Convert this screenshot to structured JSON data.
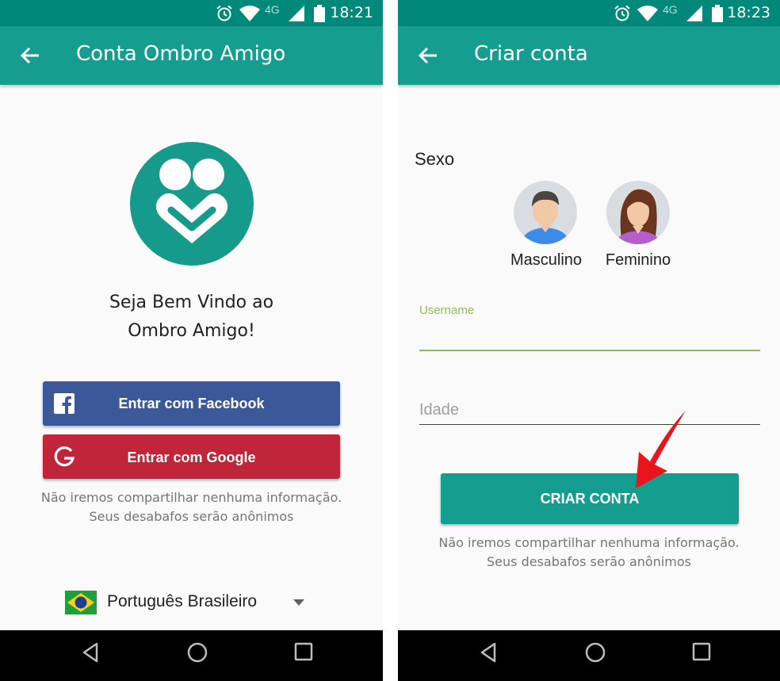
{
  "left_screen": {
    "status_time": "18:21",
    "network_label": "4G",
    "title": "Conta Ombro Amigo",
    "welcome_line1": "Seja Bem Vindo ao",
    "welcome_line2": "Ombro Amigo!",
    "facebook_button": "Entrar com Facebook",
    "google_button": "Entrar com Google",
    "note_line1": "Não iremos compartilhar nenhuma informação.",
    "note_line2": "Seus desabafos serão anônimos",
    "language": "Português Brasileiro"
  },
  "right_screen": {
    "status_time": "18:23",
    "network_label": "4G",
    "title": "Criar conta",
    "sex_label": "Sexo",
    "male_label": "Masculino",
    "female_label": "Feminino",
    "username_label": "Username",
    "age_placeholder": "Idade",
    "create_button": "CRIAR CONTA",
    "note_line1": "Não iremos compartilhar nenhuma informação.",
    "note_line2": "Seus desabafos serão anônimos"
  },
  "colors": {
    "primary": "#159e8f",
    "status_bar": "#00897b",
    "facebook": "#3b5998",
    "google": "#c0253a",
    "accent_green": "#8bc34a",
    "annotation_arrow": "#e8161c"
  },
  "icons": [
    "back-arrow-icon",
    "alarm-icon",
    "wifi-icon",
    "signal-icon",
    "battery-icon",
    "facebook-icon",
    "google-icon",
    "brazil-flag-icon",
    "dropdown-arrow-icon",
    "male-avatar-icon",
    "female-avatar-icon",
    "nav-back-icon",
    "nav-home-icon",
    "nav-recents-icon"
  ]
}
